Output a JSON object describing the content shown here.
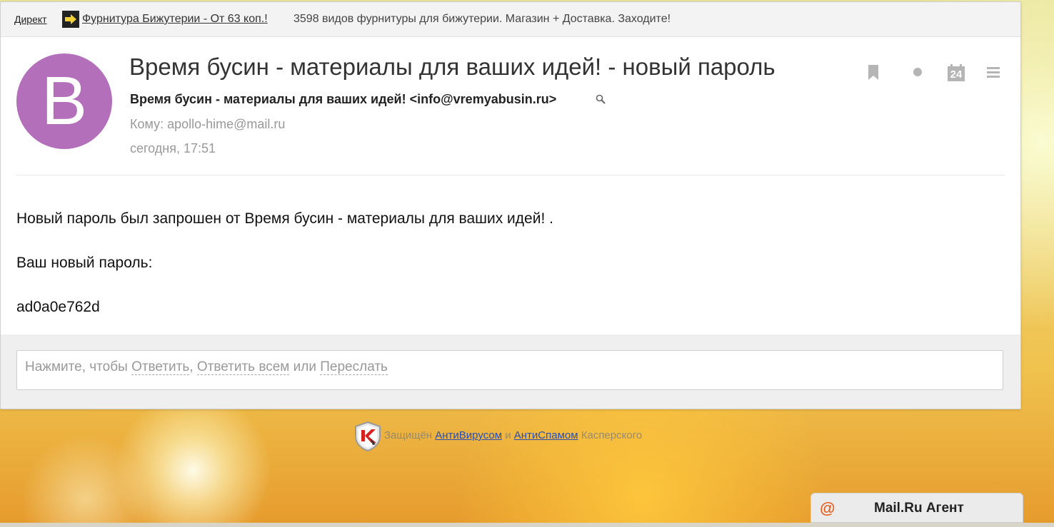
{
  "ad": {
    "direct_label": "Директ",
    "link_text": "Фурнитура Бижутерии - От 63 коп.!",
    "description": "3598 видов фурнитуры для бижутерии. Магазин + Доставка. Заходите!"
  },
  "message": {
    "avatar_letter": "B",
    "avatar_color": "#b46fba",
    "subject": "Время бусин - материалы для ваших идей! - новый пароль",
    "sender": "Время бусин - материалы для ваших идей! <info@vremyabusin.ru>",
    "to_label": "Кому:",
    "to_address": "apollo-hime@mail.ru",
    "date": "сегодня, 17:51",
    "calendar_day": "24",
    "body": [
      "Новый пароль был запрошен от Время бусин - материалы для ваших идей! .",
      "Ваш новый пароль:",
      "ad0a0e762d"
    ]
  },
  "reply": {
    "prefix": "Нажмите, чтобы",
    "reply_label": "Ответить",
    "comma": ",",
    "reply_all_label": "Ответить всем",
    "or_label": "или",
    "forward_label": "Переслать"
  },
  "kaspersky": {
    "prefix": "Защищён",
    "antivirus_label": "АнтиВирусом",
    "and_label": "и",
    "antispam_label": "АнтиСпамом",
    "suffix": "Касперского"
  },
  "agent": {
    "label": "Mail.Ru Агент",
    "icon_text": "@"
  }
}
